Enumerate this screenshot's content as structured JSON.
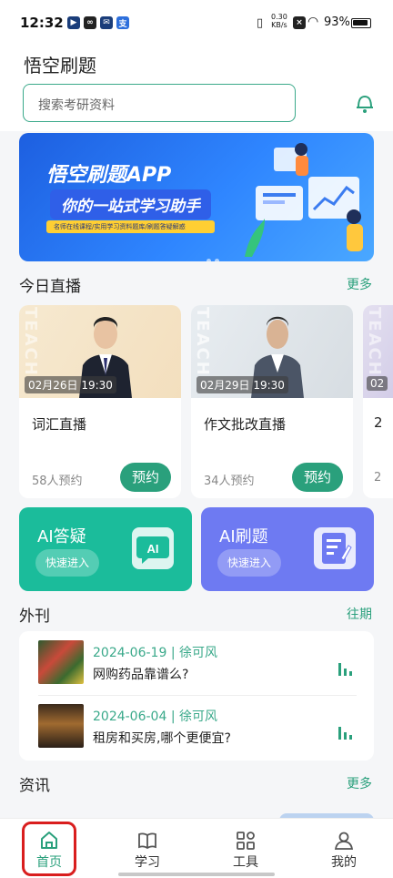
{
  "status_bar": {
    "time": "12:32",
    "network_speed": "0.30",
    "network_unit": "KB/s",
    "battery": "93%"
  },
  "header": {
    "app_title": "悟空刷题",
    "search_placeholder": "搜索考研资料"
  },
  "banner": {
    "title": "悟空刷题APP",
    "subtitle": "你的一站式学习助手",
    "tagline": "名师在线课程/实用学习资料题库/刷题答疑解惑"
  },
  "live_section": {
    "title": "今日直播",
    "more": "更多",
    "watermark": "TEACH",
    "cards": [
      {
        "time": "02月26日 19:30",
        "name": "词汇直播",
        "count": "58人预约",
        "action": "预约"
      },
      {
        "time": "02月29日 19:30",
        "name": "作文批改直播",
        "count": "34人预约",
        "action": "预约"
      },
      {
        "time": "02",
        "name": "2",
        "count": "2"
      }
    ]
  },
  "ai_tiles": [
    {
      "title": "AI答疑",
      "action": "快速进入",
      "color": "#1bbc9b"
    },
    {
      "title": "AI刷题",
      "action": "快速进入",
      "color": "#6e7af2"
    }
  ],
  "journal": {
    "title": "外刊",
    "more": "往期",
    "items": [
      {
        "date": "2024-06-19",
        "author": "徐可风",
        "title": "网购药品靠谱么?"
      },
      {
        "date": "2024-06-04",
        "author": "徐可风",
        "title": "租房和买房,哪个更便宜?"
      }
    ]
  },
  "news": {
    "title": "资讯",
    "more": "更多"
  },
  "tabbar": [
    {
      "label": "首页",
      "icon": "home-icon",
      "active": true
    },
    {
      "label": "学习",
      "icon": "book-icon"
    },
    {
      "label": "工具",
      "icon": "grid-icon"
    },
    {
      "label": "我的",
      "icon": "user-icon"
    }
  ],
  "colors": {
    "accent": "#2aa07c",
    "highlight": "#d91e1e"
  }
}
